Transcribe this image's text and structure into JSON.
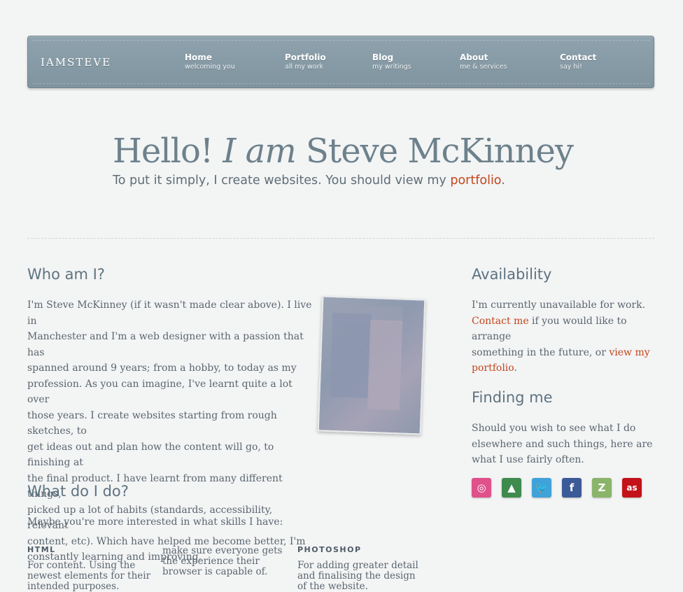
{
  "nav": {
    "logo": "IAMSTEVE",
    "items": [
      {
        "title": "Home",
        "sub": "welcoming you"
      },
      {
        "title": "Portfolio",
        "sub": "all my work"
      },
      {
        "title": "Blog",
        "sub": "my writings"
      },
      {
        "title": "About",
        "sub": "me & services"
      },
      {
        "title": "Contact",
        "sub": "say hi!"
      }
    ]
  },
  "hero": {
    "hello": "Hello! ",
    "iam": "I am",
    "name": " Steve McKinney",
    "sub_prefix": "To put it simply, I create websites. You should view my ",
    "sub_link": "portfolio",
    "sub_suffix": "."
  },
  "who": {
    "heading": "Who am I?",
    "lines": [
      "I'm Steve McKinney (if it wasn't made clear above). I live in",
      "Manchester and I'm a web designer with a passion that has",
      "spanned around 9 years; from a hobby, to today as my",
      "profession. As you can imagine, I've learnt quite a lot over",
      "those years. I create websites starting from rough sketches, to",
      "get ideas out and plan how the content will go, to finishing at",
      "the final product. I have learnt from many different things,",
      "picked up a lot of habits (standards, accessibility, relevant",
      "content, etc). Which have helped me become better, I'm",
      "constantly learning and improving."
    ]
  },
  "what": {
    "heading": "What do I do?",
    "intro": "Maybe you're more interested in what skills I have:",
    "html_title": "HTML",
    "html_lines": [
      "For content. Using the",
      "newest elements for their",
      "intended purposes."
    ],
    "col2_lines": [
      "make sure everyone gets",
      "the experience their",
      "browser is capable of."
    ],
    "photoshop_title": "PHOTOSHOP",
    "photoshop_lines": [
      "For adding greater detail",
      "and finalising the design",
      "of the website."
    ]
  },
  "availability": {
    "heading": "Availability",
    "line1": "I'm currently unavailable for work.",
    "contact_link": "Contact me",
    "line2_rest": " if you would like to arrange",
    "line3_prefix": "something in the future, or ",
    "view_link_a": "view my",
    "view_link_b": "portfolio",
    "line4_suffix": "."
  },
  "finding": {
    "heading": "Finding me",
    "lines": [
      "Should you wish to see what I do",
      "elsewhere and such things, here are",
      "what I use fairly often."
    ],
    "icons": [
      {
        "name": "dribbble-icon",
        "glyph": "◎",
        "color": "#e0508a"
      },
      {
        "name": "forrst-icon",
        "glyph": "▲",
        "color": "#3e8b4d"
      },
      {
        "name": "twitter-icon",
        "glyph": "🐦",
        "color": "#3fa2d9"
      },
      {
        "name": "facebook-icon",
        "glyph": "f",
        "color": "#3b5a98"
      },
      {
        "name": "zerply-icon",
        "glyph": "Z",
        "color": "#8ab46a"
      },
      {
        "name": "lastfm-icon",
        "glyph": "as",
        "color": "#c3121a"
      }
    ]
  }
}
